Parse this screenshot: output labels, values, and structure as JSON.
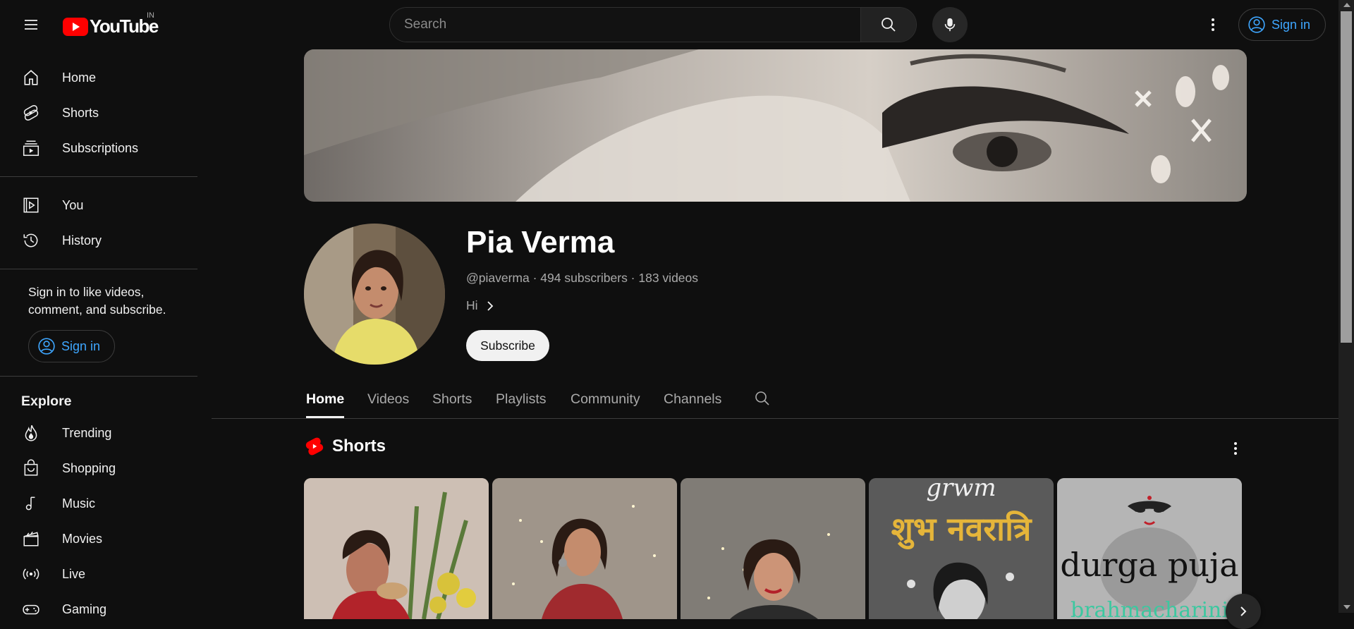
{
  "header": {
    "logo_text": "YouTube",
    "region": "IN",
    "search_placeholder": "Search",
    "signin_label": "Sign in",
    "icons": {
      "menu": "hamburger-icon",
      "search": "search-icon",
      "mic": "microphone-icon",
      "more": "more-vertical-icon",
      "account": "account-circle-icon"
    }
  },
  "sidebar": {
    "primary": [
      {
        "label": "Home",
        "icon": "home-icon"
      },
      {
        "label": "Shorts",
        "icon": "shorts-icon"
      },
      {
        "label": "Subscriptions",
        "icon": "subscriptions-icon"
      }
    ],
    "you": [
      {
        "label": "You",
        "icon": "you-library-icon"
      },
      {
        "label": "History",
        "icon": "history-icon"
      }
    ],
    "signin_blurb": "Sign in to like videos, comment, and subscribe.",
    "signin_label": "Sign in",
    "explore_title": "Explore",
    "explore": [
      {
        "label": "Trending",
        "icon": "trending-icon"
      },
      {
        "label": "Shopping",
        "icon": "shopping-bag-icon"
      },
      {
        "label": "Music",
        "icon": "music-note-icon"
      },
      {
        "label": "Movies",
        "icon": "movies-clapper-icon"
      },
      {
        "label": "Live",
        "icon": "live-broadcast-icon"
      },
      {
        "label": "Gaming",
        "icon": "gaming-controller-icon"
      }
    ]
  },
  "channel": {
    "name": "Pia Verma",
    "meta": "@piaverma · 494 subscribers · 183 videos",
    "description": "Hi",
    "subscribe_label": "Subscribe"
  },
  "tabs": [
    {
      "label": "Home",
      "active": true
    },
    {
      "label": "Videos",
      "active": false
    },
    {
      "label": "Shorts",
      "active": false
    },
    {
      "label": "Playlists",
      "active": false
    },
    {
      "label": "Community",
      "active": false
    },
    {
      "label": "Channels",
      "active": false
    }
  ],
  "shorts_section": {
    "title": "Shorts",
    "cards": [
      {
        "overlay_text": ""
      },
      {
        "overlay_text": ""
      },
      {
        "overlay_text": ""
      },
      {
        "overlay_top": "grwm",
        "overlay_text": "शुभ नवरात्रि"
      },
      {
        "overlay_text": "durga puja",
        "overlay_sub": "brahmacharini"
      }
    ]
  },
  "colors": {
    "background": "#0f0f0f",
    "accent_red": "#ff0000",
    "link_blue": "#3ea6ff",
    "muted_text": "#aaaaaa"
  }
}
